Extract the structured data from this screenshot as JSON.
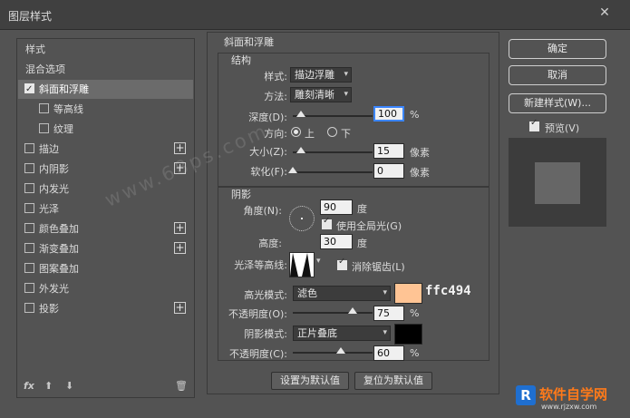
{
  "window": {
    "title": "图层样式",
    "close_glyph": "✕"
  },
  "styles_list": [
    {
      "label": "样式",
      "checkbox": false,
      "plus": false,
      "checked": false,
      "selected": false
    },
    {
      "label": "混合选项",
      "checkbox": false,
      "plus": false,
      "checked": false,
      "selected": false
    },
    {
      "label": "斜面和浮雕",
      "checkbox": true,
      "plus": false,
      "checked": true,
      "selected": true
    },
    {
      "label": "等高线",
      "checkbox": true,
      "plus": false,
      "checked": false,
      "selected": false,
      "sub": true
    },
    {
      "label": "纹理",
      "checkbox": true,
      "plus": false,
      "checked": false,
      "selected": false,
      "sub": true
    },
    {
      "label": "描边",
      "checkbox": true,
      "plus": true,
      "checked": false,
      "selected": false
    },
    {
      "label": "内阴影",
      "checkbox": true,
      "plus": true,
      "checked": false,
      "selected": false
    },
    {
      "label": "内发光",
      "checkbox": true,
      "plus": false,
      "checked": false,
      "selected": false
    },
    {
      "label": "光泽",
      "checkbox": true,
      "plus": false,
      "checked": false,
      "selected": false
    },
    {
      "label": "颜色叠加",
      "checkbox": true,
      "plus": true,
      "checked": false,
      "selected": false
    },
    {
      "label": "渐变叠加",
      "checkbox": true,
      "plus": true,
      "checked": false,
      "selected": false
    },
    {
      "label": "图案叠加",
      "checkbox": true,
      "plus": false,
      "checked": false,
      "selected": false
    },
    {
      "label": "外发光",
      "checkbox": true,
      "plus": false,
      "checked": false,
      "selected": false
    },
    {
      "label": "投影",
      "checkbox": true,
      "plus": true,
      "checked": false,
      "selected": false
    }
  ],
  "left_footer": {
    "fx": "fx",
    "up": "⬆",
    "down": "⬇",
    "trash": "🗑"
  },
  "bevel": {
    "section_title": "斜面和浮雕",
    "structure_title": "结构",
    "style_label": "样式:",
    "style_value": "描边浮雕",
    "technique_label": "方法:",
    "technique_value": "雕刻清晰",
    "depth_label": "深度(D):",
    "depth_value": "100",
    "depth_unit": "%",
    "depth_level": 0.1,
    "direction_label": "方向:",
    "direction_up": "上",
    "direction_down": "下",
    "direction_selected": "上",
    "size_label": "大小(Z):",
    "size_value": "15",
    "size_unit": "像素",
    "size_level": 0.1,
    "soften_label": "软化(F):",
    "soften_value": "0",
    "soften_unit": "像素",
    "soften_level": 0.0
  },
  "shading": {
    "title": "阴影",
    "angle_label": "角度(N):",
    "angle_value": "90",
    "angle_unit": "度",
    "global_light_label": "使用全局光(G)",
    "global_light_checked": true,
    "altitude_label": "高度:",
    "altitude_value": "30",
    "altitude_unit": "度",
    "gloss_label": "光泽等高线:",
    "antialias_label": "消除锯齿(L)",
    "antialias_checked": true,
    "highlight_mode_label": "高光模式:",
    "highlight_mode_value": "滤色",
    "highlight_color": "#ffc494",
    "highlight_color_text": "ffc494",
    "highlight_opacity_label": "不透明度(O):",
    "highlight_opacity_value": "75",
    "highlight_opacity_unit": "%",
    "highlight_opacity_level": 0.75,
    "shadow_mode_label": "阴影模式:",
    "shadow_mode_value": "正片叠底",
    "shadow_color": "#000000",
    "shadow_opacity_label": "不透明度(C):",
    "shadow_opacity_value": "60",
    "shadow_opacity_unit": "%",
    "shadow_opacity_level": 0.6
  },
  "bottom_buttons": {
    "make_default": "设置为默认值",
    "reset_default": "复位为默认值"
  },
  "right_buttons": {
    "ok": "确定",
    "cancel": "取消",
    "new_style": "新建样式(W)...",
    "preview_label": "预览(V)",
    "preview_checked": true
  },
  "watermark": "www.68ps.com",
  "logo": {
    "text1": "软件自学网",
    "text2": "www.rjzxw.com"
  }
}
